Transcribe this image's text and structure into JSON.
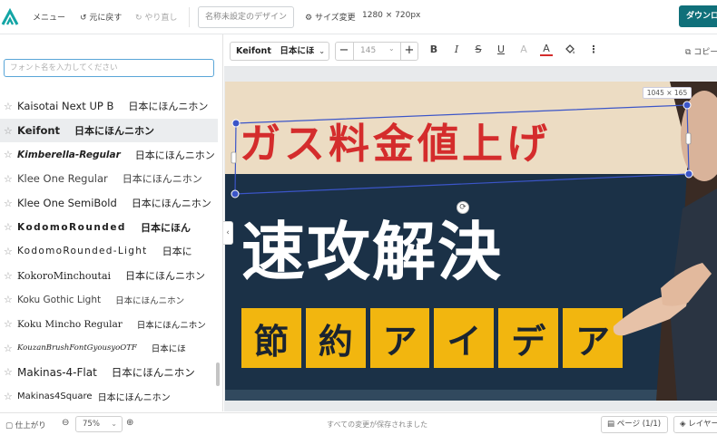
{
  "topbar": {
    "menu_label": "メニュー",
    "undo_label": "元に戻す",
    "redo_label": "やり直し",
    "design_name": "名称未設定のデザイン",
    "resize_label": "サイズ変更",
    "canvas_size": "1280 × 720px",
    "download_label": "ダウンロ"
  },
  "font_panel": {
    "search_placeholder": "フォント名を入力してください",
    "fonts": [
      {
        "name": "Kaisotai Next UP B",
        "sample": "日本にほんニホン",
        "selected": false
      },
      {
        "name": "Keifont",
        "sample": "日本にほんニホン",
        "selected": true
      },
      {
        "name": "Kimberella-Regular",
        "sample": "日本にほんニホン",
        "selected": false
      },
      {
        "name": "Klee One Regular",
        "sample": "日本にほんニホン",
        "selected": false
      },
      {
        "name": "Klee One SemiBold",
        "sample": "日本にほんニホン",
        "selected": false
      },
      {
        "name": "KodomoRounded",
        "sample": "日本にほん",
        "selected": false
      },
      {
        "name": "KodomoRounded-Light",
        "sample": "日本に",
        "selected": false
      },
      {
        "name": "KokoroMinchoutai",
        "sample": "日本にほんニホン",
        "selected": false
      },
      {
        "name": "Koku Gothic Light",
        "sample": "日本にほんニホン",
        "selected": false
      },
      {
        "name": "Koku Mincho Regular",
        "sample": "日本にほんニホン",
        "selected": false
      },
      {
        "name": "KouzanBrushFontGyousyoOTF",
        "sample": "日本にほ",
        "selected": false
      },
      {
        "name": "Makinas-4-Flat",
        "sample": "日本にほんニホン",
        "selected": false
      },
      {
        "name": "Makinas4Square",
        "sample": "日本にほんニホン",
        "selected": false
      }
    ]
  },
  "text_toolbar": {
    "font_family": "Keifont　日本にほ",
    "font_size": "145",
    "copy_label": "コピー"
  },
  "canvas": {
    "size_tag": "1045 × 165",
    "headline_red": "ガス料金値上げ",
    "headline_white": "速攻解決",
    "tiles": [
      "節",
      "約",
      "ア",
      "イ",
      "デ",
      "ア"
    ]
  },
  "bottombar": {
    "finish_label": "仕上がり",
    "zoom_value": "75%",
    "save_status": "すべての変更が保存されました",
    "pages_label": "ページ",
    "pages_count": "(1/1)",
    "layers_label": "レイヤー"
  },
  "colors": {
    "accent": "#10707a",
    "headline_red": "#d42c2c",
    "navy": "#1b3147",
    "tile_yellow": "#f2b60f",
    "banner_beige": "#ecdcc3",
    "selection_blue": "#3b55c8"
  },
  "icons": [
    "logo-icon",
    "undo-icon",
    "redo-icon",
    "gear-icon",
    "star-icon",
    "minus-icon",
    "plus-icon",
    "bold-icon",
    "italic-icon",
    "strikethrough-icon",
    "underline-icon",
    "font-color-icon",
    "fill-icon",
    "more-icon",
    "copy-icon",
    "chevron-down-icon",
    "chevron-left-icon",
    "rotate-icon",
    "finish-icon",
    "zoom-out-icon",
    "zoom-in-icon",
    "page-icon",
    "layers-icon"
  ]
}
